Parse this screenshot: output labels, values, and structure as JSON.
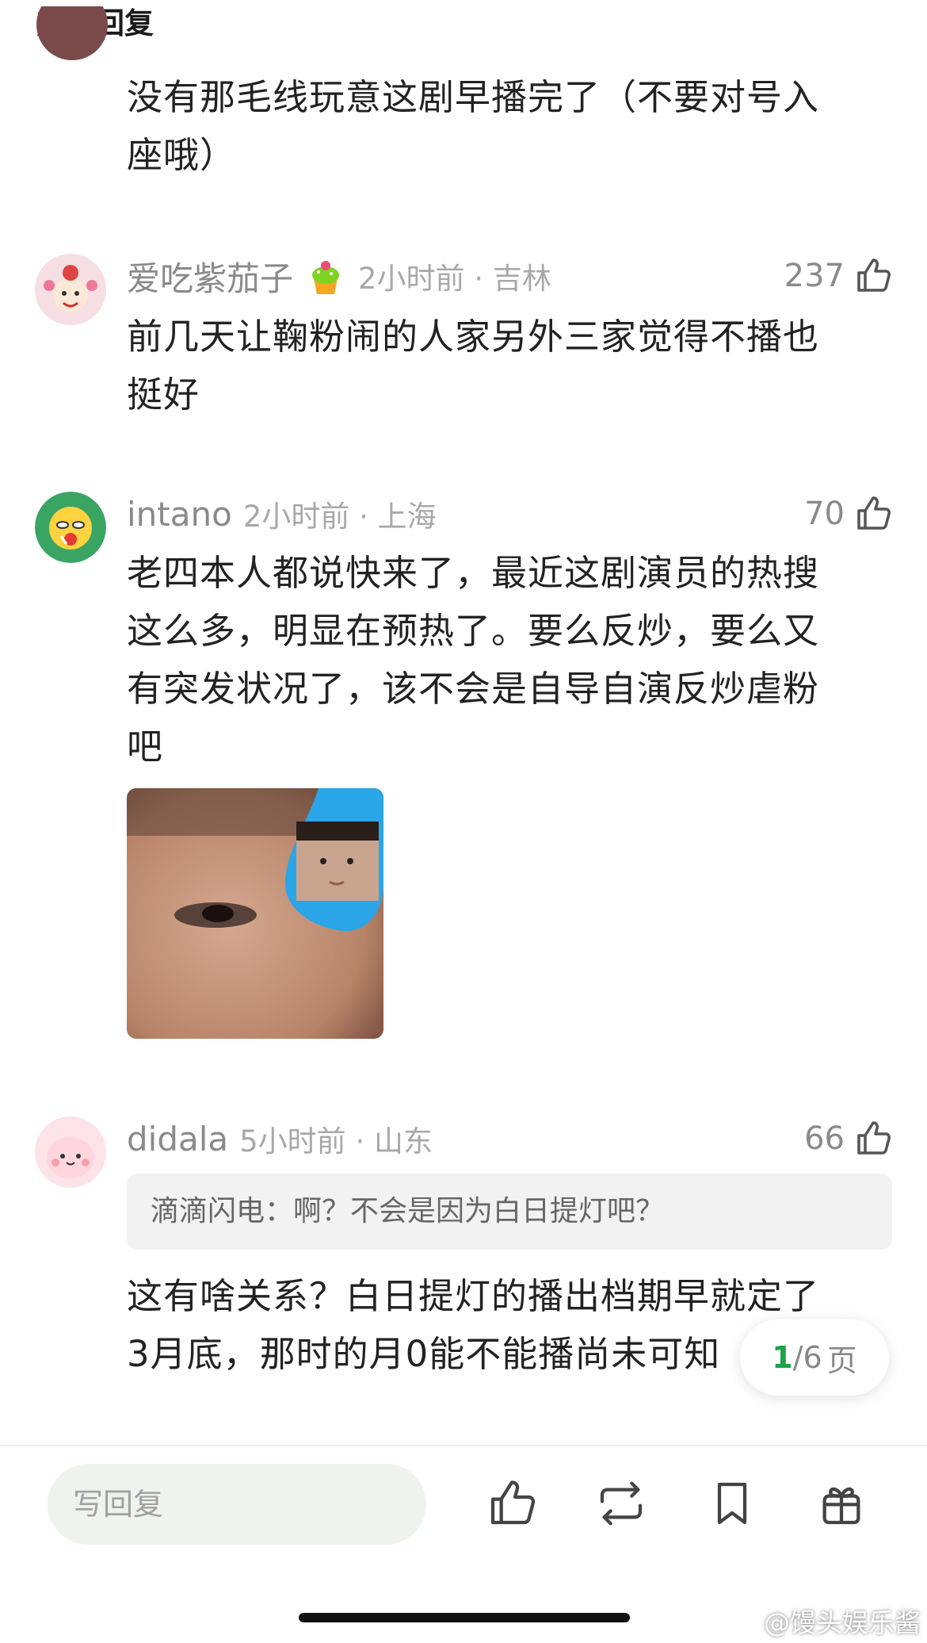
{
  "header": {
    "title": "热门回复"
  },
  "comments": [
    {
      "text_lines": [
        "没有那毛线玩意这剧早播完了（不要对号入",
        "座哦）"
      ]
    },
    {
      "username": "爱吃紫茄子",
      "badge_icon": "cupcake-icon",
      "time": "2小时前 · 吉林",
      "likes": "237",
      "text_lines": [
        "前几天让鞠粉闹的人家另外三家觉得不播也",
        "挺好"
      ]
    },
    {
      "username": "intano",
      "time": "2小时前 · 上海",
      "likes": "70",
      "text_lines": [
        "老四本人都说快来了，最近这剧演员的热搜",
        "这么多，明显在预热了。要么反炒，要么又",
        "有突发状况了，该不会是自导自演反炒虐粉",
        "吧"
      ]
    },
    {
      "username": "didala",
      "time": "5小时前 · 山东",
      "likes": "66",
      "quote": "滴滴闪电：啊？不会是因为白日提灯吧？",
      "text_lines": [
        "这有啥关系？白日提灯的播出档期早就定了",
        "3月底，那时的月0能不能播尚未可知"
      ]
    }
  ],
  "pagination": {
    "current": "1",
    "total": "/6",
    "unit": "页"
  },
  "bottom_bar": {
    "reply_placeholder": "写回复",
    "icons": [
      "thumbs-up-icon",
      "repost-icon",
      "bookmark-icon",
      "gift-icon"
    ]
  },
  "watermark": "@馒头娱乐酱",
  "colors": {
    "accent": "#1aa34a",
    "input_bg": "#eef3ee"
  }
}
